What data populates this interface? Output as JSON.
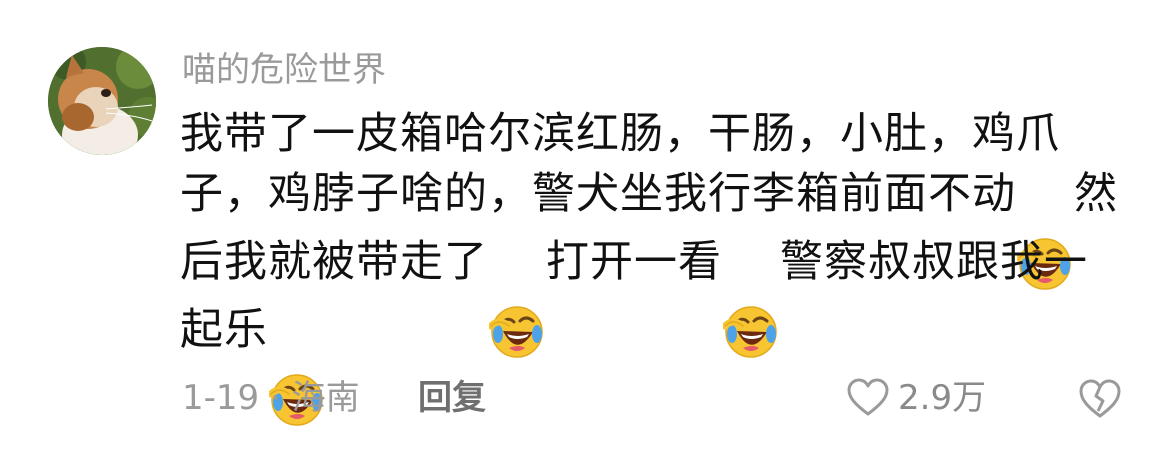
{
  "comment": {
    "username": "喵的危险世界",
    "body": [
      {
        "type": "text",
        "text": "我带了一皮箱哈尔滨红肠，干肠，小肚，鸡爪子，鸡脖子啥的，警犬坐我行李箱前面不动"
      },
      {
        "type": "emoji",
        "name": "rolling-laughing-emoji"
      },
      {
        "type": "text",
        "text": "然后我就被带走了"
      },
      {
        "type": "emoji",
        "name": "rolling-laughing-emoji"
      },
      {
        "type": "text",
        "text": "打开一看"
      },
      {
        "type": "emoji",
        "name": "rolling-laughing-emoji"
      },
      {
        "type": "text",
        "text": "警察叔叔跟我一起乐"
      },
      {
        "type": "emoji",
        "name": "rolling-laughing-emoji"
      }
    ],
    "meta": "1-19 · 海南",
    "reply_label": "回复",
    "like_count": "2.9万",
    "icons": {
      "like": "heart-outline-icon",
      "dislike": "broken-heart-icon"
    }
  }
}
